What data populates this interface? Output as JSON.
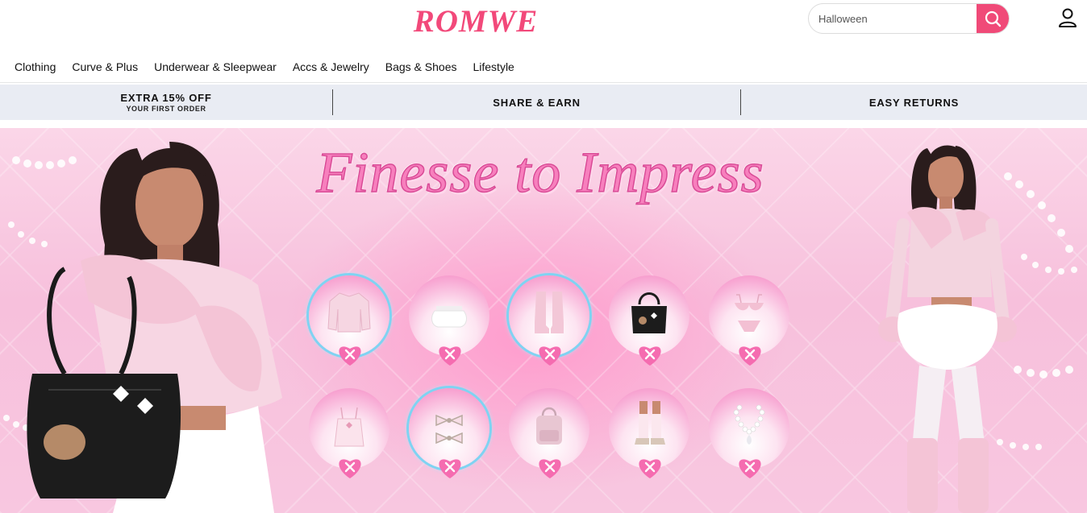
{
  "header": {
    "logo": "ROMWE",
    "search_placeholder": "Halloween",
    "search_icon": "search-icon",
    "account_icon": "user-icon"
  },
  "nav": {
    "items": [
      {
        "label": "Clothing"
      },
      {
        "label": "Curve & Plus"
      },
      {
        "label": "Underwear & Sleepwear"
      },
      {
        "label": "Accs & Jewelry"
      },
      {
        "label": "Bags & Shoes"
      },
      {
        "label": "Lifestyle"
      }
    ]
  },
  "promo": {
    "items": [
      {
        "title": "EXTRA 15% OFF",
        "subtitle": "YOUR FIRST ORDER"
      },
      {
        "title": "SHARE & EARN"
      },
      {
        "title": "EASY RETURNS"
      }
    ]
  },
  "hero": {
    "title": "Finesse to Impress",
    "items": [
      {
        "product": "cardigan",
        "selected": true,
        "icon": "heart-close-icon"
      },
      {
        "product": "mini skirt",
        "selected": false,
        "icon": "heart-close-icon"
      },
      {
        "product": "boots",
        "selected": true,
        "icon": "heart-close-icon"
      },
      {
        "product": "handbag",
        "selected": false,
        "icon": "heart-close-icon"
      },
      {
        "product": "lingerie set",
        "selected": false,
        "icon": "heart-close-icon"
      },
      {
        "product": "camisole",
        "selected": false,
        "icon": "heart-close-icon"
      },
      {
        "product": "hair bows",
        "selected": true,
        "icon": "heart-close-icon"
      },
      {
        "product": "backpack",
        "selected": false,
        "icon": "heart-close-icon"
      },
      {
        "product": "socks and shoes",
        "selected": false,
        "icon": "heart-close-icon"
      },
      {
        "product": "pearl necklace",
        "selected": false,
        "icon": "heart-close-icon"
      }
    ]
  },
  "colors": {
    "brand": "#f2497a",
    "search_button": "#f04a78",
    "promo_background": "#e9ecf3",
    "hero_pink": "#f7c0dc",
    "heart": "#f56cb0",
    "selected_ring": "#7fd3f2"
  }
}
